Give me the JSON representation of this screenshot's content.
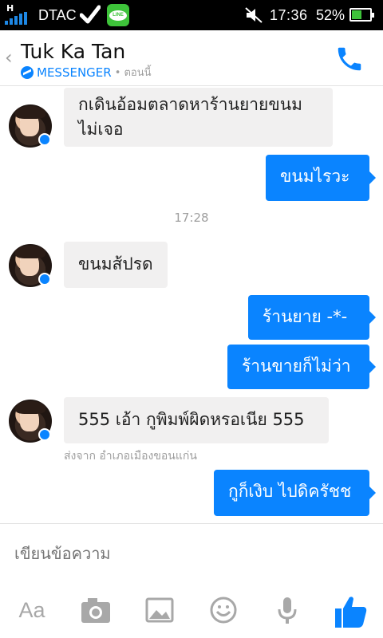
{
  "status_bar": {
    "network_h": "H",
    "carrier": "DTAC",
    "line_app": "LINE",
    "time": "17:36",
    "battery_pct": "52%",
    "battery_level": 0.52
  },
  "header": {
    "back_glyph": "‹",
    "title": "Tuk Ka Tan",
    "service": "MESSENGER",
    "status_time": "• ตอนนี้",
    "accent": "#0a84ff"
  },
  "messages": [
    {
      "from": "them",
      "text": "กเดินอ้อมตลาดหาร้านยายขนม\nไม่เจอ"
    },
    {
      "from": "me",
      "text": "ขนมไรวะ"
    },
    {
      "separator": "17:28"
    },
    {
      "from": "them",
      "text": "ขนมส้ปรด"
    },
    {
      "from": "me",
      "text": "ร้านยาย -*-"
    },
    {
      "from": "me",
      "text": "ร้านขายก็ไม่ว่า"
    },
    {
      "from": "them",
      "text": "555 เอ้า กูพิมพ์ผิดหรอเนีย 555",
      "location": "ส่งจาก อำเภอเมืองขอนแก่น"
    },
    {
      "from": "me",
      "text": "กูก็เงิบ ไปดิครัชช"
    }
  ],
  "composer": {
    "placeholder": "เขียนข้อความ",
    "aa_label": "Aa",
    "icons": [
      "text-format-icon",
      "camera-icon",
      "image-icon",
      "emoji-icon",
      "microphone-icon",
      "like-icon"
    ]
  }
}
